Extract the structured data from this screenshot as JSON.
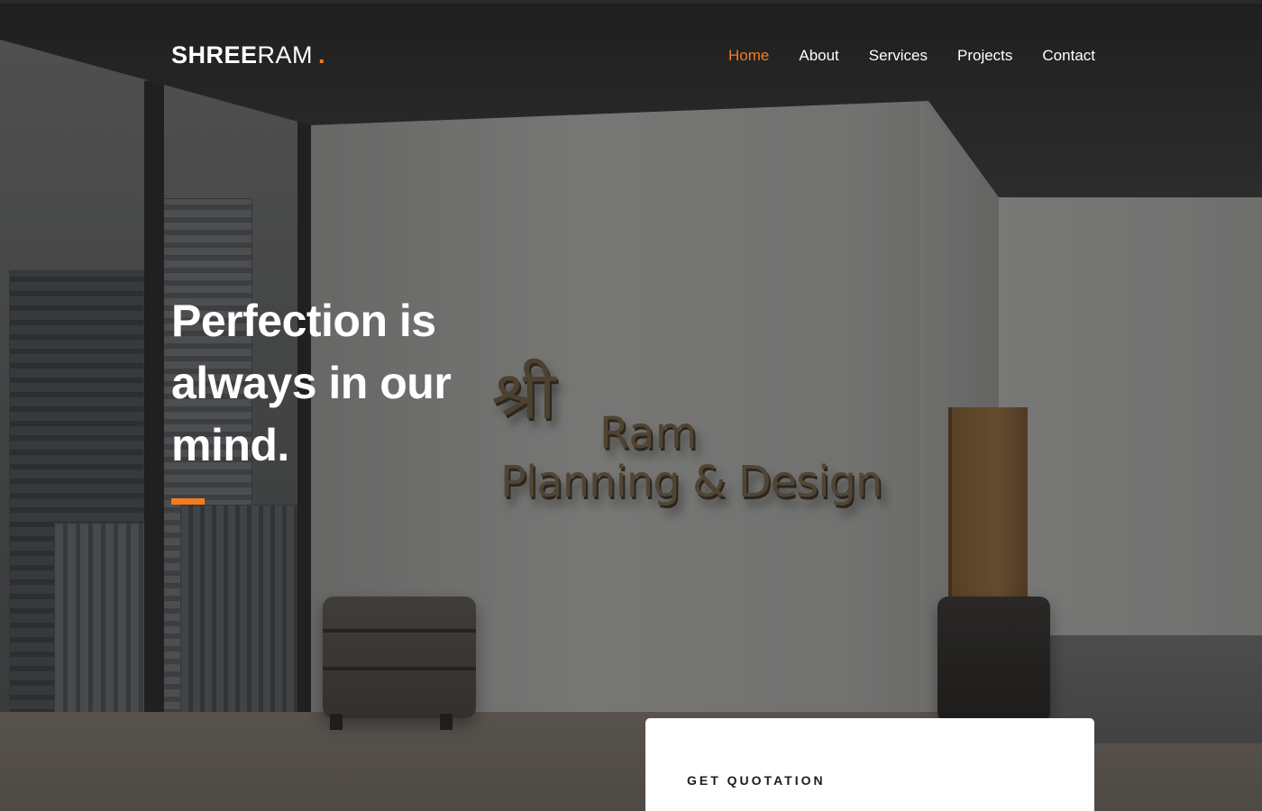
{
  "header": {
    "brand_bold": "SHREE",
    "brand_light": "RAM",
    "brand_dot": "."
  },
  "nav": {
    "items": [
      "Home",
      "About",
      "Services",
      "Projects",
      "Contact"
    ],
    "active": "Home"
  },
  "hero": {
    "headline_line1": "Perfection is",
    "headline_line2": "always in our",
    "headline_line3": "mind.",
    "wall_logo": {
      "mark": "श्री",
      "name": "Ram",
      "subtitle": "Planning & Design"
    }
  },
  "quote_card": {
    "title": "GET QUOTATION"
  },
  "colors": {
    "accent": "#f47c20",
    "text_light": "#ffffff",
    "card_bg": "#ffffff"
  }
}
